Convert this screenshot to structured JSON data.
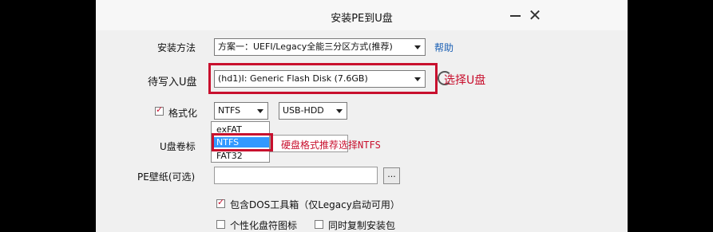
{
  "window": {
    "title": "安装PE到U盘",
    "close_glyph": "✕"
  },
  "install_method": {
    "label": "安装方法",
    "value": "方案一：UEFI/Legacy全能三分区方式(推荐)",
    "help": "帮助"
  },
  "target_disk": {
    "label": "待写入U盘",
    "value": "(hd1)I: Generic Flash Disk (7.6GB)"
  },
  "format": {
    "checkbox_label": "格式化",
    "checked": true,
    "fs_value": "NTFS",
    "mode_value": "USB-HDD",
    "options": [
      "exFAT",
      "NTFS",
      "FAT32"
    ]
  },
  "volume_label": {
    "label": "U盘卷标"
  },
  "wallpaper": {
    "label": "PE壁纸(可选)",
    "browse": "..."
  },
  "dos_tools": {
    "label": "包含DOS工具箱（仅Legacy启动可用）",
    "checked": true
  },
  "personalize": {
    "label": "个性化盘符图标",
    "checked": false
  },
  "copy_pkg": {
    "label": "同时复制安装包",
    "checked": false
  },
  "annotations": {
    "select_usb": "选择U盘",
    "ntfs_hint": "硬盘格式推荐选择NTFS",
    "color": "#c8102e"
  }
}
